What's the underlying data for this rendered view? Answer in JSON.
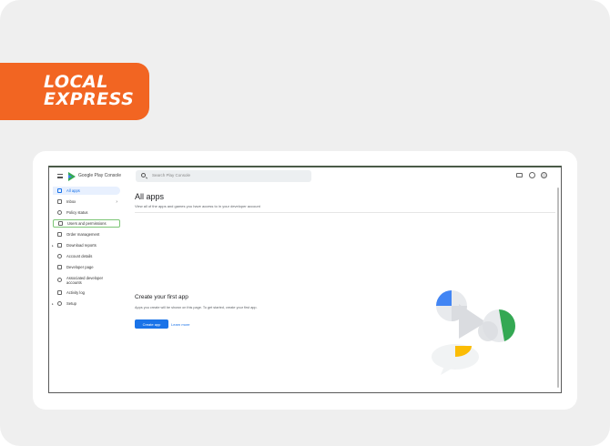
{
  "brand": {
    "line1": "LOCAL",
    "line2": "EXPRESS",
    "color": "#f26522"
  },
  "console": {
    "product_name": "Google Play Console",
    "search_placeholder": "Search Play Console",
    "icons": [
      "menu-icon",
      "play-logo-icon",
      "search-icon",
      "keyboard-icon",
      "help-icon",
      "avatar-icon"
    ]
  },
  "sidebar": {
    "items": [
      {
        "label": "All apps",
        "icon": "grid-icon",
        "active": true
      },
      {
        "label": "Inbox",
        "icon": "inbox-icon",
        "chevron": "›"
      },
      {
        "label": "Policy status",
        "icon": "shield-icon"
      },
      {
        "label": "Users and permissions",
        "icon": "users-icon",
        "highlighted": true
      },
      {
        "label": "Order management",
        "icon": "card-icon"
      },
      {
        "label": "Download reports",
        "icon": "download-icon",
        "caret": "▸"
      },
      {
        "label": "Account details",
        "icon": "account-icon"
      },
      {
        "label": "Developer page",
        "icon": "page-icon"
      },
      {
        "label": "Associated developer accounts",
        "icon": "link-icon"
      },
      {
        "label": "Activity log",
        "icon": "log-icon"
      },
      {
        "label": "Setup",
        "icon": "gear-icon",
        "caret": "▸"
      }
    ]
  },
  "main": {
    "title": "All apps",
    "subtitle": "View all of the apps and games you have access to in your developer account",
    "empty_state": {
      "title": "Create your first app",
      "description": "Apps you create will be shown on this page. To get started, create your first app.",
      "primary_button": "Create app",
      "secondary_link": "Learn more"
    }
  },
  "colors": {
    "accent": "#1a73e8",
    "active_bg": "#e8f0fe",
    "highlight_border": "#7cc576",
    "illus_blue": "#4285f4",
    "illus_green": "#34a853",
    "illus_yellow": "#fbbc04",
    "illus_gray": "#dadce0"
  }
}
